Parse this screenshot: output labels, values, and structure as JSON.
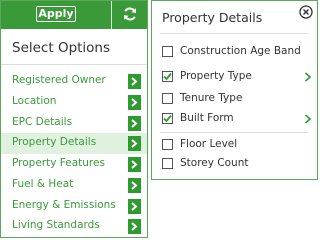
{
  "toolbar": {
    "apply_label": "Apply"
  },
  "left": {
    "title": "Select Options",
    "items": [
      {
        "label": "Registered Owner"
      },
      {
        "label": "Location"
      },
      {
        "label": "EPC Details"
      },
      {
        "label": "Property Details"
      },
      {
        "label": "Property Features"
      },
      {
        "label": "Fuel & Heat"
      },
      {
        "label": "Energy & Emissions"
      },
      {
        "label": "Living Standards"
      }
    ],
    "active_item": "Property Details"
  },
  "right": {
    "title": "Property Details",
    "items": [
      {
        "label": "Construction Age Band",
        "checked": false,
        "has_submenu": false
      },
      {
        "label": "Property Type",
        "checked": true,
        "has_submenu": true
      },
      {
        "label": "Tenure Type",
        "checked": false,
        "has_submenu": false
      },
      {
        "label": "Built Form",
        "checked": true,
        "has_submenu": true
      },
      {
        "label": "Floor Level",
        "checked": false,
        "has_submenu": false
      },
      {
        "label": "Storey Count",
        "checked": false,
        "has_submenu": false
      }
    ]
  },
  "colors": {
    "accent_green": "#3a9a3a",
    "active_row_bg": "#e0f1e0",
    "border_green": "#5aa85a"
  },
  "icons": {
    "refresh": "refresh-icon",
    "close": "close-circle-icon",
    "arrow": "chevron-right-icon",
    "check": "check-icon"
  }
}
